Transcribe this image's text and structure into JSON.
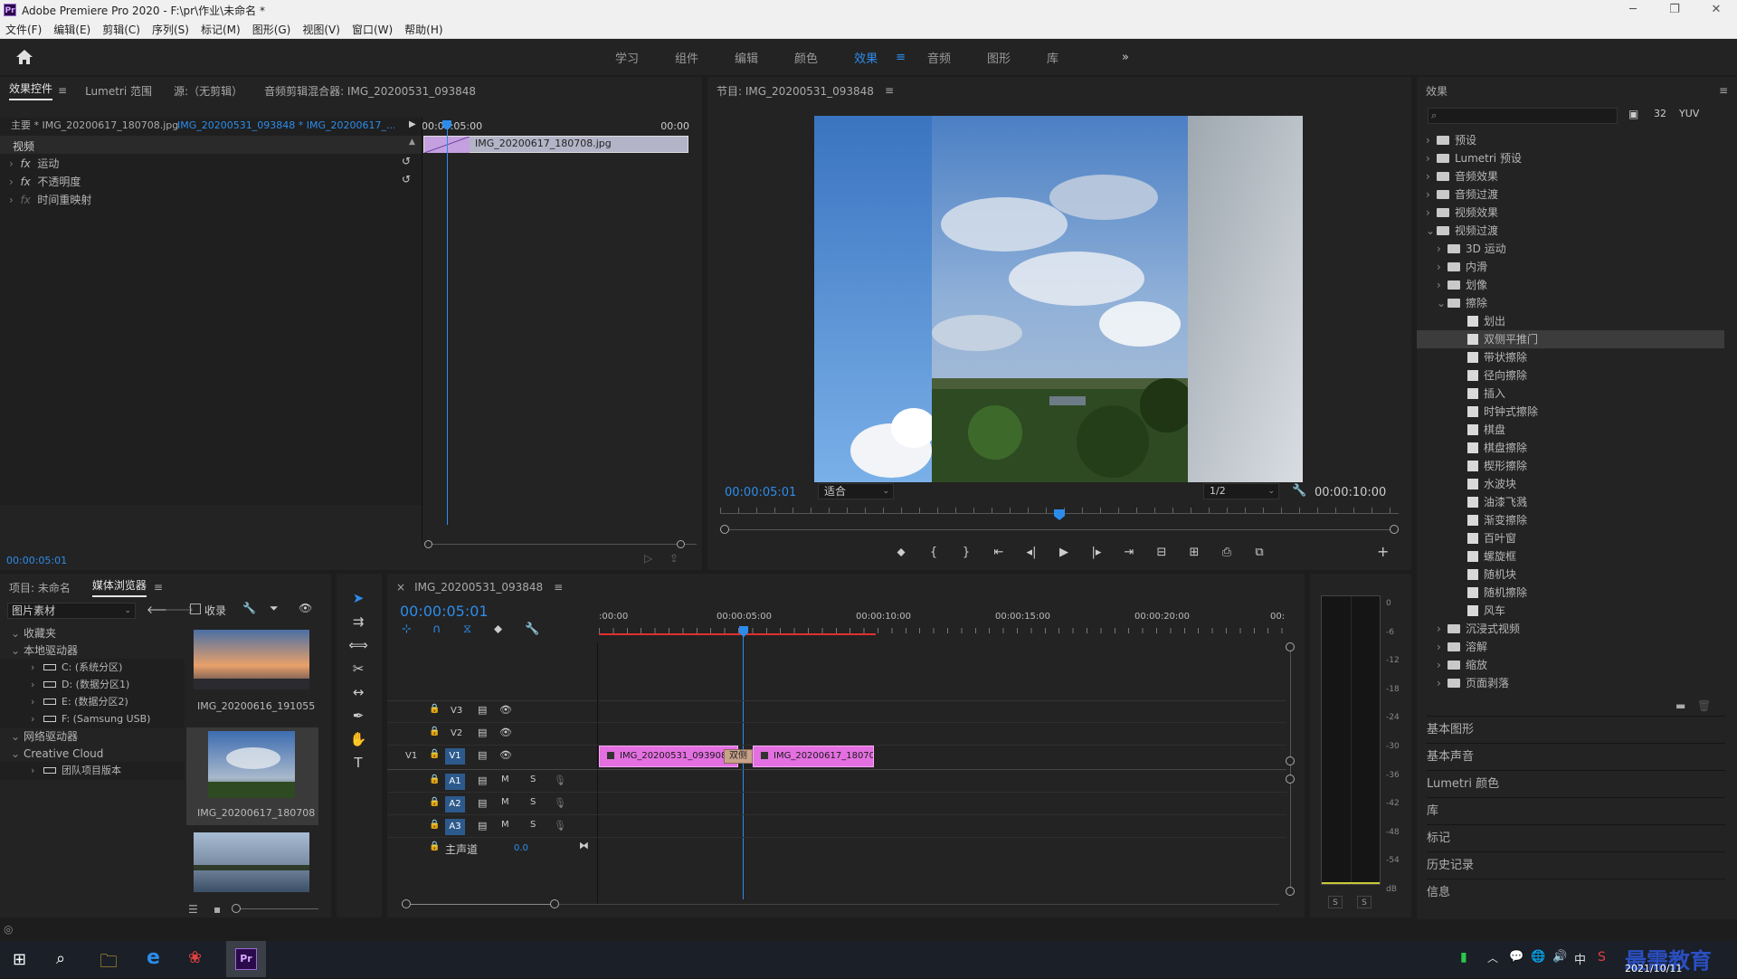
{
  "window": {
    "title": "Adobe Premiere Pro 2020 - F:\\pr\\作业\\未命名 *",
    "logo": "Pr"
  },
  "menu": [
    "文件(F)",
    "编辑(E)",
    "剪辑(C)",
    "序列(S)",
    "标记(M)",
    "图形(G)",
    "视图(V)",
    "窗口(W)",
    "帮助(H)"
  ],
  "workspaces": {
    "tabs": [
      "学习",
      "组件",
      "编辑",
      "颜色",
      "效果",
      "音频",
      "图形",
      "库"
    ],
    "active": "效果",
    "more": "»"
  },
  "effect_controls": {
    "tabs": [
      "效果控件",
      "Lumetri 范围",
      "源:（无剪辑）",
      "音频剪辑混合器: IMG_20200531_093848"
    ],
    "master": "主要 * IMG_20200617_180708.jpg",
    "sequence": "IMG_20200531_093848 * IMG_20200617_...",
    "ruler_start": "00:00:05:00",
    "ruler_end": "00:00",
    "clip_name": "IMG_20200617_180708.jpg",
    "section": "视频",
    "props": [
      "运动",
      "不透明度",
      "时间重映射"
    ],
    "timecode": "00:00:05:01"
  },
  "program": {
    "title": "节目: IMG_20200531_093848",
    "timecode": "00:00:05:01",
    "fit": "适合",
    "resolution": "1/2",
    "duration": "00:00:10:00"
  },
  "effects_panel": {
    "title": "效果",
    "tree": [
      {
        "label": "预设",
        "level": 0,
        "type": "folder"
      },
      {
        "label": "Lumetri 预设",
        "level": 0,
        "type": "folder"
      },
      {
        "label": "音频效果",
        "level": 0,
        "type": "folder"
      },
      {
        "label": "音频过渡",
        "level": 0,
        "type": "folder"
      },
      {
        "label": "视频效果",
        "level": 0,
        "type": "folder"
      },
      {
        "label": "视频过渡",
        "level": 0,
        "type": "folder",
        "open": true
      },
      {
        "label": "3D 运动",
        "level": 1,
        "type": "folder"
      },
      {
        "label": "内滑",
        "level": 1,
        "type": "folder"
      },
      {
        "label": "划像",
        "level": 1,
        "type": "folder"
      },
      {
        "label": "擦除",
        "level": 1,
        "type": "folder",
        "open": true
      },
      {
        "label": "划出",
        "level": 2,
        "type": "item"
      },
      {
        "label": "双侧平推门",
        "level": 2,
        "type": "item",
        "selected": true
      },
      {
        "label": "带状擦除",
        "level": 2,
        "type": "item"
      },
      {
        "label": "径向擦除",
        "level": 2,
        "type": "item"
      },
      {
        "label": "插入",
        "level": 2,
        "type": "item"
      },
      {
        "label": "时钟式擦除",
        "level": 2,
        "type": "item"
      },
      {
        "label": "棋盘",
        "level": 2,
        "type": "item"
      },
      {
        "label": "棋盘擦除",
        "level": 2,
        "type": "item"
      },
      {
        "label": "楔形擦除",
        "level": 2,
        "type": "item"
      },
      {
        "label": "水波块",
        "level": 2,
        "type": "item"
      },
      {
        "label": "油漆飞溅",
        "level": 2,
        "type": "item"
      },
      {
        "label": "渐变擦除",
        "level": 2,
        "type": "item"
      },
      {
        "label": "百叶窗",
        "level": 2,
        "type": "item"
      },
      {
        "label": "螺旋框",
        "level": 2,
        "type": "item"
      },
      {
        "label": "随机块",
        "level": 2,
        "type": "item"
      },
      {
        "label": "随机擦除",
        "level": 2,
        "type": "item"
      },
      {
        "label": "风车",
        "level": 2,
        "type": "item"
      },
      {
        "label": "沉浸式视频",
        "level": 1,
        "type": "folder"
      },
      {
        "label": "溶解",
        "level": 1,
        "type": "folder"
      },
      {
        "label": "缩放",
        "level": 1,
        "type": "folder"
      },
      {
        "label": "页面剥落",
        "level": 1,
        "type": "folder"
      }
    ],
    "sections": [
      "基本图形",
      "基本声音",
      "Lumetri 颜色",
      "库",
      "标记",
      "历史记录",
      "信息"
    ]
  },
  "project": {
    "tabs": [
      "项目: 未命名",
      "媒体浏览器"
    ],
    "filter": "图片素材",
    "favorites_checkbox": "收录",
    "tree": [
      {
        "label": "收藏夹",
        "level": 0
      },
      {
        "label": "本地驱动器",
        "level": 0
      },
      {
        "label": "C: (系统分区)",
        "level": 1
      },
      {
        "label": "D: (数据分区1)",
        "level": 1
      },
      {
        "label": "E: (数据分区2)",
        "level": 1
      },
      {
        "label": "F: (Samsung USB)",
        "level": 1
      },
      {
        "label": "网络驱动器",
        "level": 0
      },
      {
        "label": "Creative Cloud",
        "level": 0
      },
      {
        "label": "团队项目版本",
        "level": 1
      }
    ],
    "thumbs": [
      "IMG_20200616_191055",
      "IMG_20200617_180708",
      ""
    ]
  },
  "timeline": {
    "title": "IMG_20200531_093848",
    "timecode": "00:00:05:01",
    "ruler": [
      ":00:00",
      "00:00:05:00",
      "00:00:10:00",
      "00:00:15:00",
      "00:00:20:00",
      "00:"
    ],
    "tracks": [
      "V3",
      "V2",
      "V1",
      "A1",
      "A2",
      "A3"
    ],
    "source_v1": "V1",
    "master": "主声道",
    "master_value": "0.0",
    "clip1": "IMG_20200531_093908.jp",
    "transition": "双侧",
    "clip2": "IMG_20200617_180708.j",
    "m_label": "M",
    "s_label": "S"
  },
  "meter": {
    "labels": [
      "0",
      "-6",
      "-12",
      "-18",
      "-24",
      "-30",
      "-36",
      "-42",
      "-48",
      "-54",
      "dB"
    ],
    "s": [
      "S",
      "S"
    ]
  },
  "taskbar": {
    "time": "",
    "date": "2021/10/11",
    "watermark": "最需教育"
  }
}
